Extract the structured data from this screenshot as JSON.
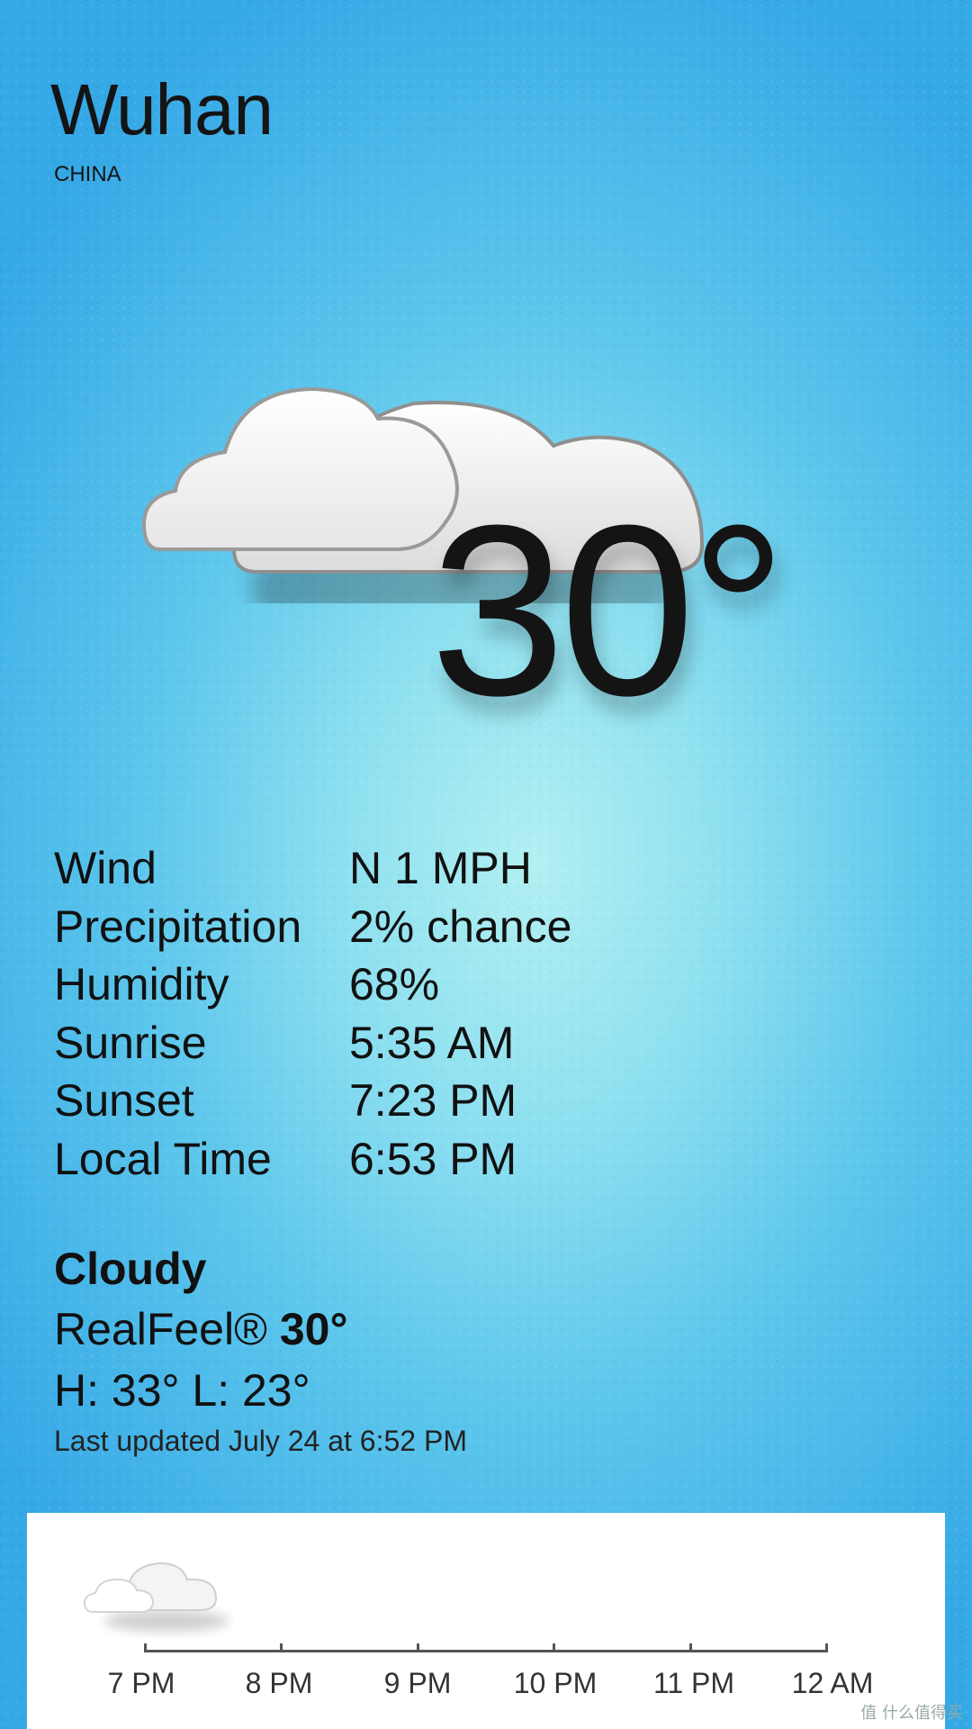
{
  "location": {
    "city": "Wuhan",
    "country": "CHINA"
  },
  "current": {
    "icon": "cloudy-icon",
    "temperature": "30°"
  },
  "details": [
    {
      "label": "Wind",
      "value": "N 1 MPH"
    },
    {
      "label": "Precipitation",
      "value": "2% chance"
    },
    {
      "label": "Humidity",
      "value": "68%"
    },
    {
      "label": "Sunrise",
      "value": "5:35 AM"
    },
    {
      "label": "Sunset",
      "value": "7:23 PM"
    },
    {
      "label": "Local Time",
      "value": "6:53 PM"
    }
  ],
  "summary": {
    "condition": "Cloudy",
    "realfeel_label": "RealFeel®",
    "realfeel_value": "30°",
    "hilo": "H: 33° L: 23°",
    "last_updated": "Last updated July 24 at 6:52 PM"
  },
  "hourly": {
    "icon": "cloudy-icon",
    "times": [
      "7 PM",
      "8 PM",
      "9 PM",
      "10 PM",
      "11 PM",
      "12 AM"
    ]
  },
  "watermark": "值 什么值得买",
  "colors": {
    "background_center": "#b2f0f2",
    "background_edge": "#35a8e6",
    "text": "#111111",
    "panel": "#ffffff"
  }
}
